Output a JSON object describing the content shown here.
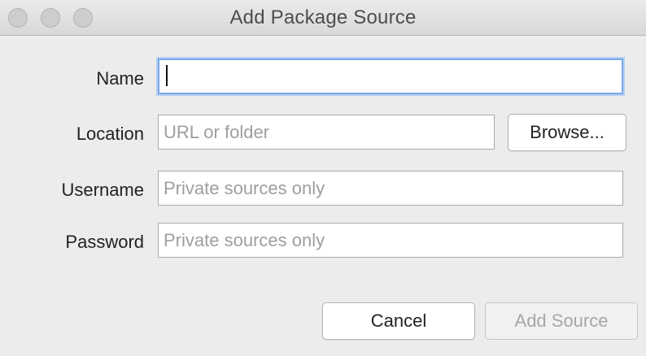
{
  "window": {
    "title": "Add Package Source"
  },
  "form": {
    "name": {
      "label": "Name",
      "value": "",
      "placeholder": ""
    },
    "location": {
      "label": "Location",
      "value": "",
      "placeholder": "URL or folder"
    },
    "username": {
      "label": "Username",
      "value": "",
      "placeholder": "Private sources only"
    },
    "password": {
      "label": "Password",
      "value": "",
      "placeholder": "Private sources only"
    }
  },
  "buttons": {
    "browse": "Browse...",
    "cancel": "Cancel",
    "add_source": "Add Source"
  },
  "colors": {
    "focus_ring": "#7aa7e8",
    "placeholder": "#9e9e9e",
    "disabled_text": "#a6a6a6"
  }
}
